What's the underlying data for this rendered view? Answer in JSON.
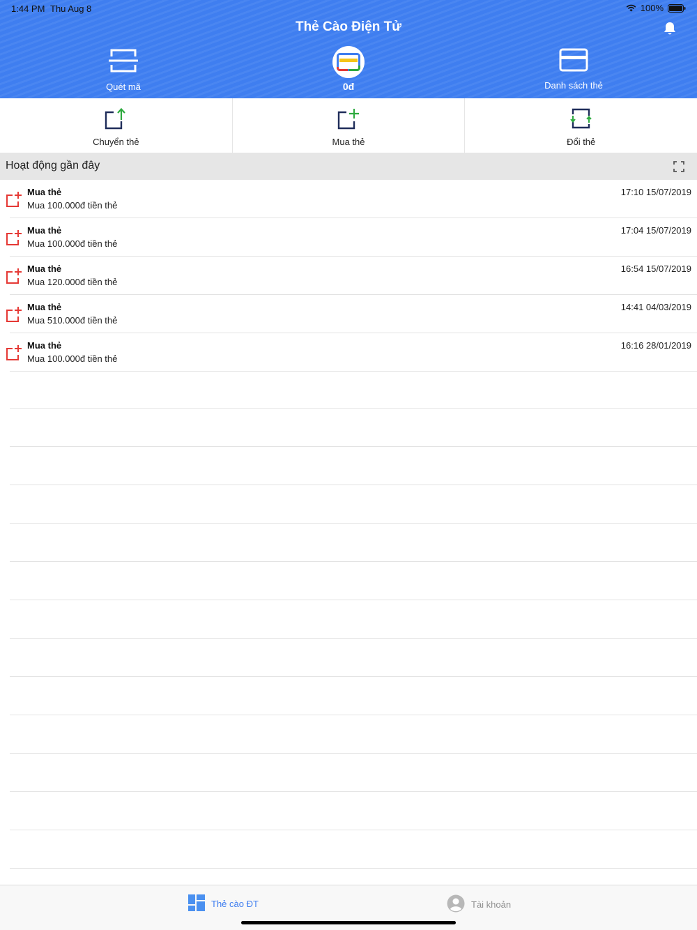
{
  "status_bar": {
    "time": "1:44 PM",
    "date": "Thu Aug 8",
    "battery": "100%"
  },
  "header": {
    "title": "Thẻ Cào Điện Tử",
    "scan_label": "Quét mã",
    "balance": "0đ",
    "card_list_label": "Danh sách thẻ"
  },
  "actions": {
    "transfer_label": "Chuyển thẻ",
    "buy_label": "Mua thẻ",
    "exchange_label": "Đổi thẻ"
  },
  "section": {
    "title": "Hoạt động gần đây"
  },
  "activities": [
    {
      "title": "Mua thẻ",
      "desc": "Mua 100.000đ tiền thẻ",
      "time": "17:10 15/07/2019"
    },
    {
      "title": "Mua thẻ",
      "desc": "Mua 100.000đ tiền thẻ",
      "time": "17:04 15/07/2019"
    },
    {
      "title": "Mua thẻ",
      "desc": "Mua 120.000đ tiền thẻ",
      "time": "16:54 15/07/2019"
    },
    {
      "title": "Mua thẻ",
      "desc": "Mua 510.000đ tiền thẻ",
      "time": "14:41 04/03/2019"
    },
    {
      "title": "Mua thẻ",
      "desc": "Mua 100.000đ tiền thẻ",
      "time": "16:16 28/01/2019"
    }
  ],
  "tabs": {
    "home": "Thẻ cào ĐT",
    "account": "Tài khoản"
  },
  "colors": {
    "primary": "#3f7ef0",
    "activity_icon": "#e53935",
    "accent_green": "#2eaa3f",
    "tab_inactive": "#8e8e8e"
  },
  "icons": {
    "scan": "scan-icon",
    "balance": "card-color-icon",
    "card_list": "card-icon",
    "transfer": "transfer-card-icon",
    "buy": "buy-card-icon",
    "exchange": "exchange-card-icon",
    "bell": "bell-icon",
    "expand": "expand-icon",
    "home_tab": "grid-icon",
    "account_tab": "user-icon"
  }
}
